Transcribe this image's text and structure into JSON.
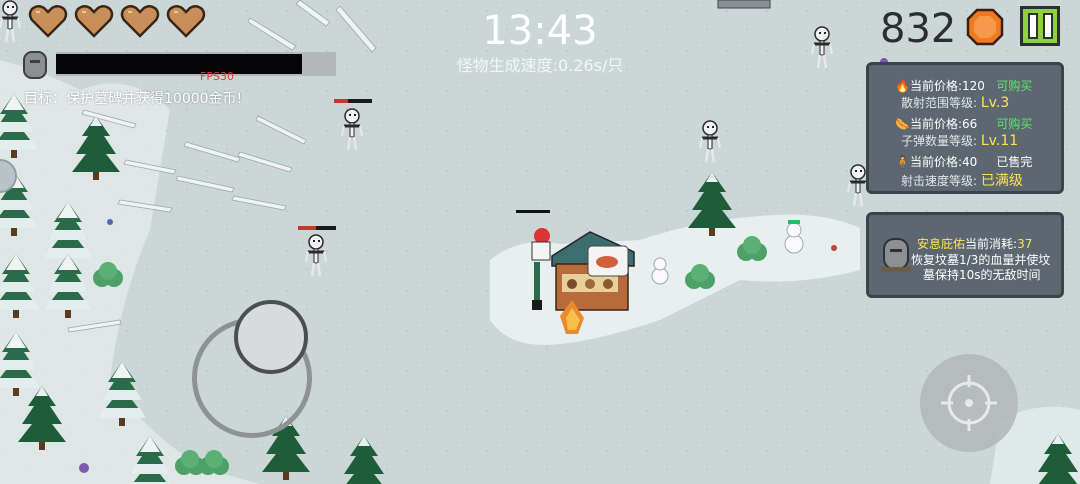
{
  "hud": {
    "timer": "13:43",
    "spawn_rate": "怪物生成速度:0.26s/只",
    "fps": "FPS30",
    "goal": "目标：保护墓碑并获得10000金币!",
    "hearts": 4,
    "base_health": 0.88
  },
  "coins": {
    "count": "832",
    "icon": "copper-coin-icon"
  },
  "pause_button": {
    "icon": "pause-icon"
  },
  "shop": {
    "items": [
      {
        "icon": "scatter-tower-icon",
        "price_label": "当前价格:",
        "price": "120",
        "status": "可购买",
        "stat_label": "散射范围等级:",
        "level": "Lv.3"
      },
      {
        "icon": "sausage-icon",
        "price_label": "当前价格:",
        "price": "66",
        "status": "可购买",
        "stat_label": "子弹数量等级:",
        "level": "Lv.11"
      },
      {
        "icon": "bullet-speed-icon",
        "price_label": "当前价格:",
        "price": "40",
        "status": "已售完",
        "stat_label": "射击速度等级:",
        "level": "已满级"
      }
    ],
    "blessing": {
      "icon": "tombstone-icon",
      "title": "安息庇佑",
      "cost_label": "当前消耗:",
      "cost": "37",
      "desc_line1": "恢复坟墓1/3的血量并使坟",
      "desc_line2": "墓保持10s的无敌时间"
    }
  },
  "controls": {
    "joystick": "movement-joystick",
    "fire": "crosshair-icon"
  },
  "colors": {
    "snow_ground": "#cfd9d9",
    "path_light": "#e6eeee",
    "pine": "#1e5a3a",
    "panel": "#5c6771",
    "green_text": "#5ce86b",
    "yellow_text": "#ffe34d",
    "pause_green": "#8cd33d"
  }
}
